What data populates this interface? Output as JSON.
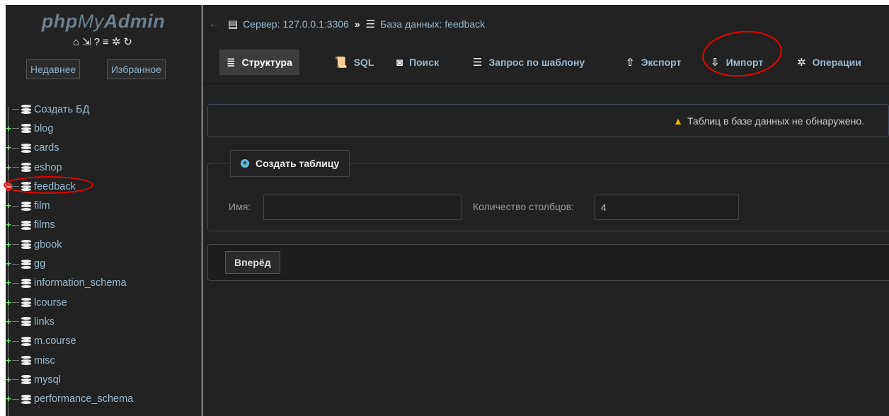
{
  "left_panel": {
    "logo": {
      "php": "php",
      "my": "My",
      "admin": "Admin"
    },
    "quick_icons": [
      "home-icon",
      "logout-icon",
      "help-icon",
      "docs-icon",
      "settings-icon",
      "reload-icon"
    ],
    "recent_label": "Недавнее",
    "favorites_label": "Избранное",
    "create_db_label": "Создать БД",
    "databases": [
      "blog",
      "cards",
      "eshop",
      "feedback",
      "film",
      "films",
      "gbook",
      "gg",
      "information_schema",
      "lcourse",
      "links",
      "m.course",
      "misc",
      "mysql",
      "performance_schema"
    ],
    "expanded_database": "feedback"
  },
  "breadcrumb": {
    "server": "Сервер: 127.0.0.1:3306",
    "separator": "»",
    "database": "База данных: feedback"
  },
  "tabs": [
    {
      "id": "structure",
      "label": "Структура",
      "icon": "structure-icon",
      "active": true
    },
    {
      "id": "sql",
      "label": "SQL",
      "icon": "sql-icon"
    },
    {
      "id": "search",
      "label": "Поиск",
      "icon": "search-icon"
    },
    {
      "id": "query",
      "label": "Запрос по шаблону",
      "icon": "query-icon"
    },
    {
      "id": "export",
      "label": "Экспорт",
      "icon": "export-icon"
    },
    {
      "id": "import",
      "label": "Импорт",
      "icon": "import-icon"
    },
    {
      "id": "operations",
      "label": "Операции",
      "icon": "operations-icon"
    }
  ],
  "notice": {
    "text": "Таблиц в базе данных не обнаружено.",
    "icon": "warning-icon"
  },
  "create_table": {
    "legend": "Создать таблицу",
    "name_label": "Имя:",
    "name_value": "",
    "columns_label": "Количество столбцов:",
    "columns_value": "4",
    "go_button": "Вперёд"
  },
  "colors": {
    "panel_bg": "#222222",
    "link": "#9bb8cc",
    "annotation": "#e00000",
    "warning": "#f4b400"
  }
}
